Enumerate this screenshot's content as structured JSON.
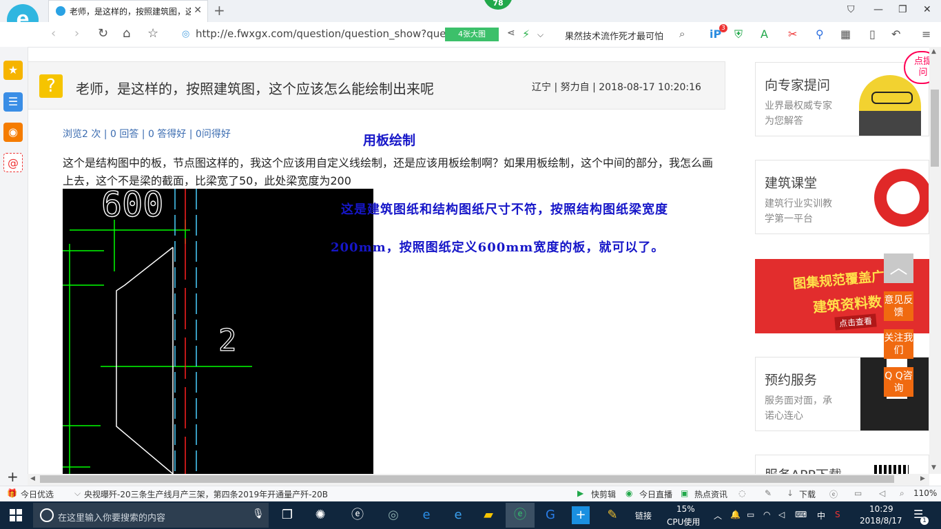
{
  "browser": {
    "tab_title": "老师，是这样的，按照建筑图，这",
    "badge_count": "78",
    "url": "http://e.fwxgx.com/question/question_show?que",
    "big_image_button": "4张大图",
    "search_text": "果然技术流作死才最可怕",
    "ext_badge": "3"
  },
  "question": {
    "title": "老师，是这样的，按照建筑图，这个应该怎么能绘制出来呢",
    "meta": "辽宁 | 努力自 | 2018-08-17 10:20:16",
    "stats": "浏览2 次 | 0 回答 | 0 答得好 | 0问得好",
    "body": "这个是结构图中的板，节点图这样的，我这个应该用自定义线绘制，还是应该用板绘制啊？如果用板绘制，这个中间的部分，我怎么画上去，这个不是梁的截面，比梁宽了50，此处梁宽度为200",
    "cad_label_600": "600",
    "cad_label_2": "2"
  },
  "answer": {
    "line1": "用板绘制",
    "line2": "这是建筑图纸和结构图纸尺寸不符，按照结构图纸梁宽度",
    "line3": "200mm，按照图纸定义600mm宽度的板，就可以了。"
  },
  "right_panel": {
    "cards": [
      {
        "title": "向专家提问",
        "desc1": "业界最权威专家",
        "desc2": "为您解答"
      },
      {
        "title": "建筑课堂",
        "desc1": "建筑行业实训教",
        "desc2": "学第一平台"
      },
      {
        "title": "预约服务",
        "desc1": "服务面对面，承",
        "desc2": "诺心连心"
      },
      {
        "title": "服务APP下载",
        "desc1": "",
        "desc2": ""
      }
    ],
    "corner_tag": "点提问",
    "banner": {
      "line1": "图集规范覆盖广",
      "line2": "建筑资料数",
      "line3": "点击查看"
    },
    "float_buttons": [
      "意见反馈",
      "关注我们",
      "Q Q咨询"
    ]
  },
  "status_bar": {
    "left": "今日优选",
    "news": "央视曝歼-20三条生产线月产三架，第四条2019年开通量产歼-20B",
    "items": [
      "快剪辑",
      "今日直播",
      "热点资讯"
    ],
    "download": "下载",
    "zoom": "110%"
  },
  "taskbar": {
    "search_placeholder": "在这里输入你要搜索的内容",
    "links": "链接",
    "cpu_percent": "15%",
    "cpu_label": "CPU使用",
    "ime": "中",
    "time": "10:29",
    "date": "2018/8/17",
    "notif_count": "1"
  }
}
